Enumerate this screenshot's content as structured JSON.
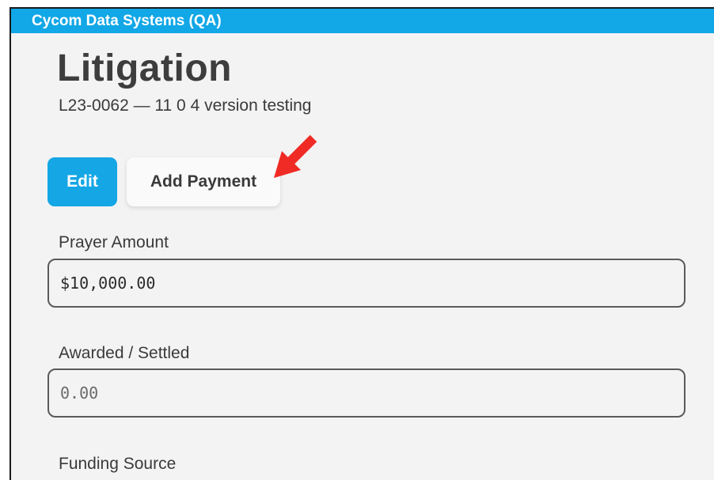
{
  "window": {
    "title": "Cycom Data Systems (QA)",
    "accent_color": "#12a7e6"
  },
  "header": {
    "title": "Litigation",
    "subtitle": "L23-0062 — 11 0 4 version testing"
  },
  "actions": {
    "edit_label": "Edit",
    "add_payment_label": "Add Payment"
  },
  "annotation": {
    "arrow_color": "#f02a24",
    "icon": "arrow-pointer-icon"
  },
  "fields": {
    "prayer_amount": {
      "label": "Prayer Amount",
      "value": "$10,000.00"
    },
    "awarded_settled": {
      "label": "Awarded / Settled",
      "placeholder": "0.00"
    },
    "funding_source": {
      "label": "Funding Source"
    }
  }
}
